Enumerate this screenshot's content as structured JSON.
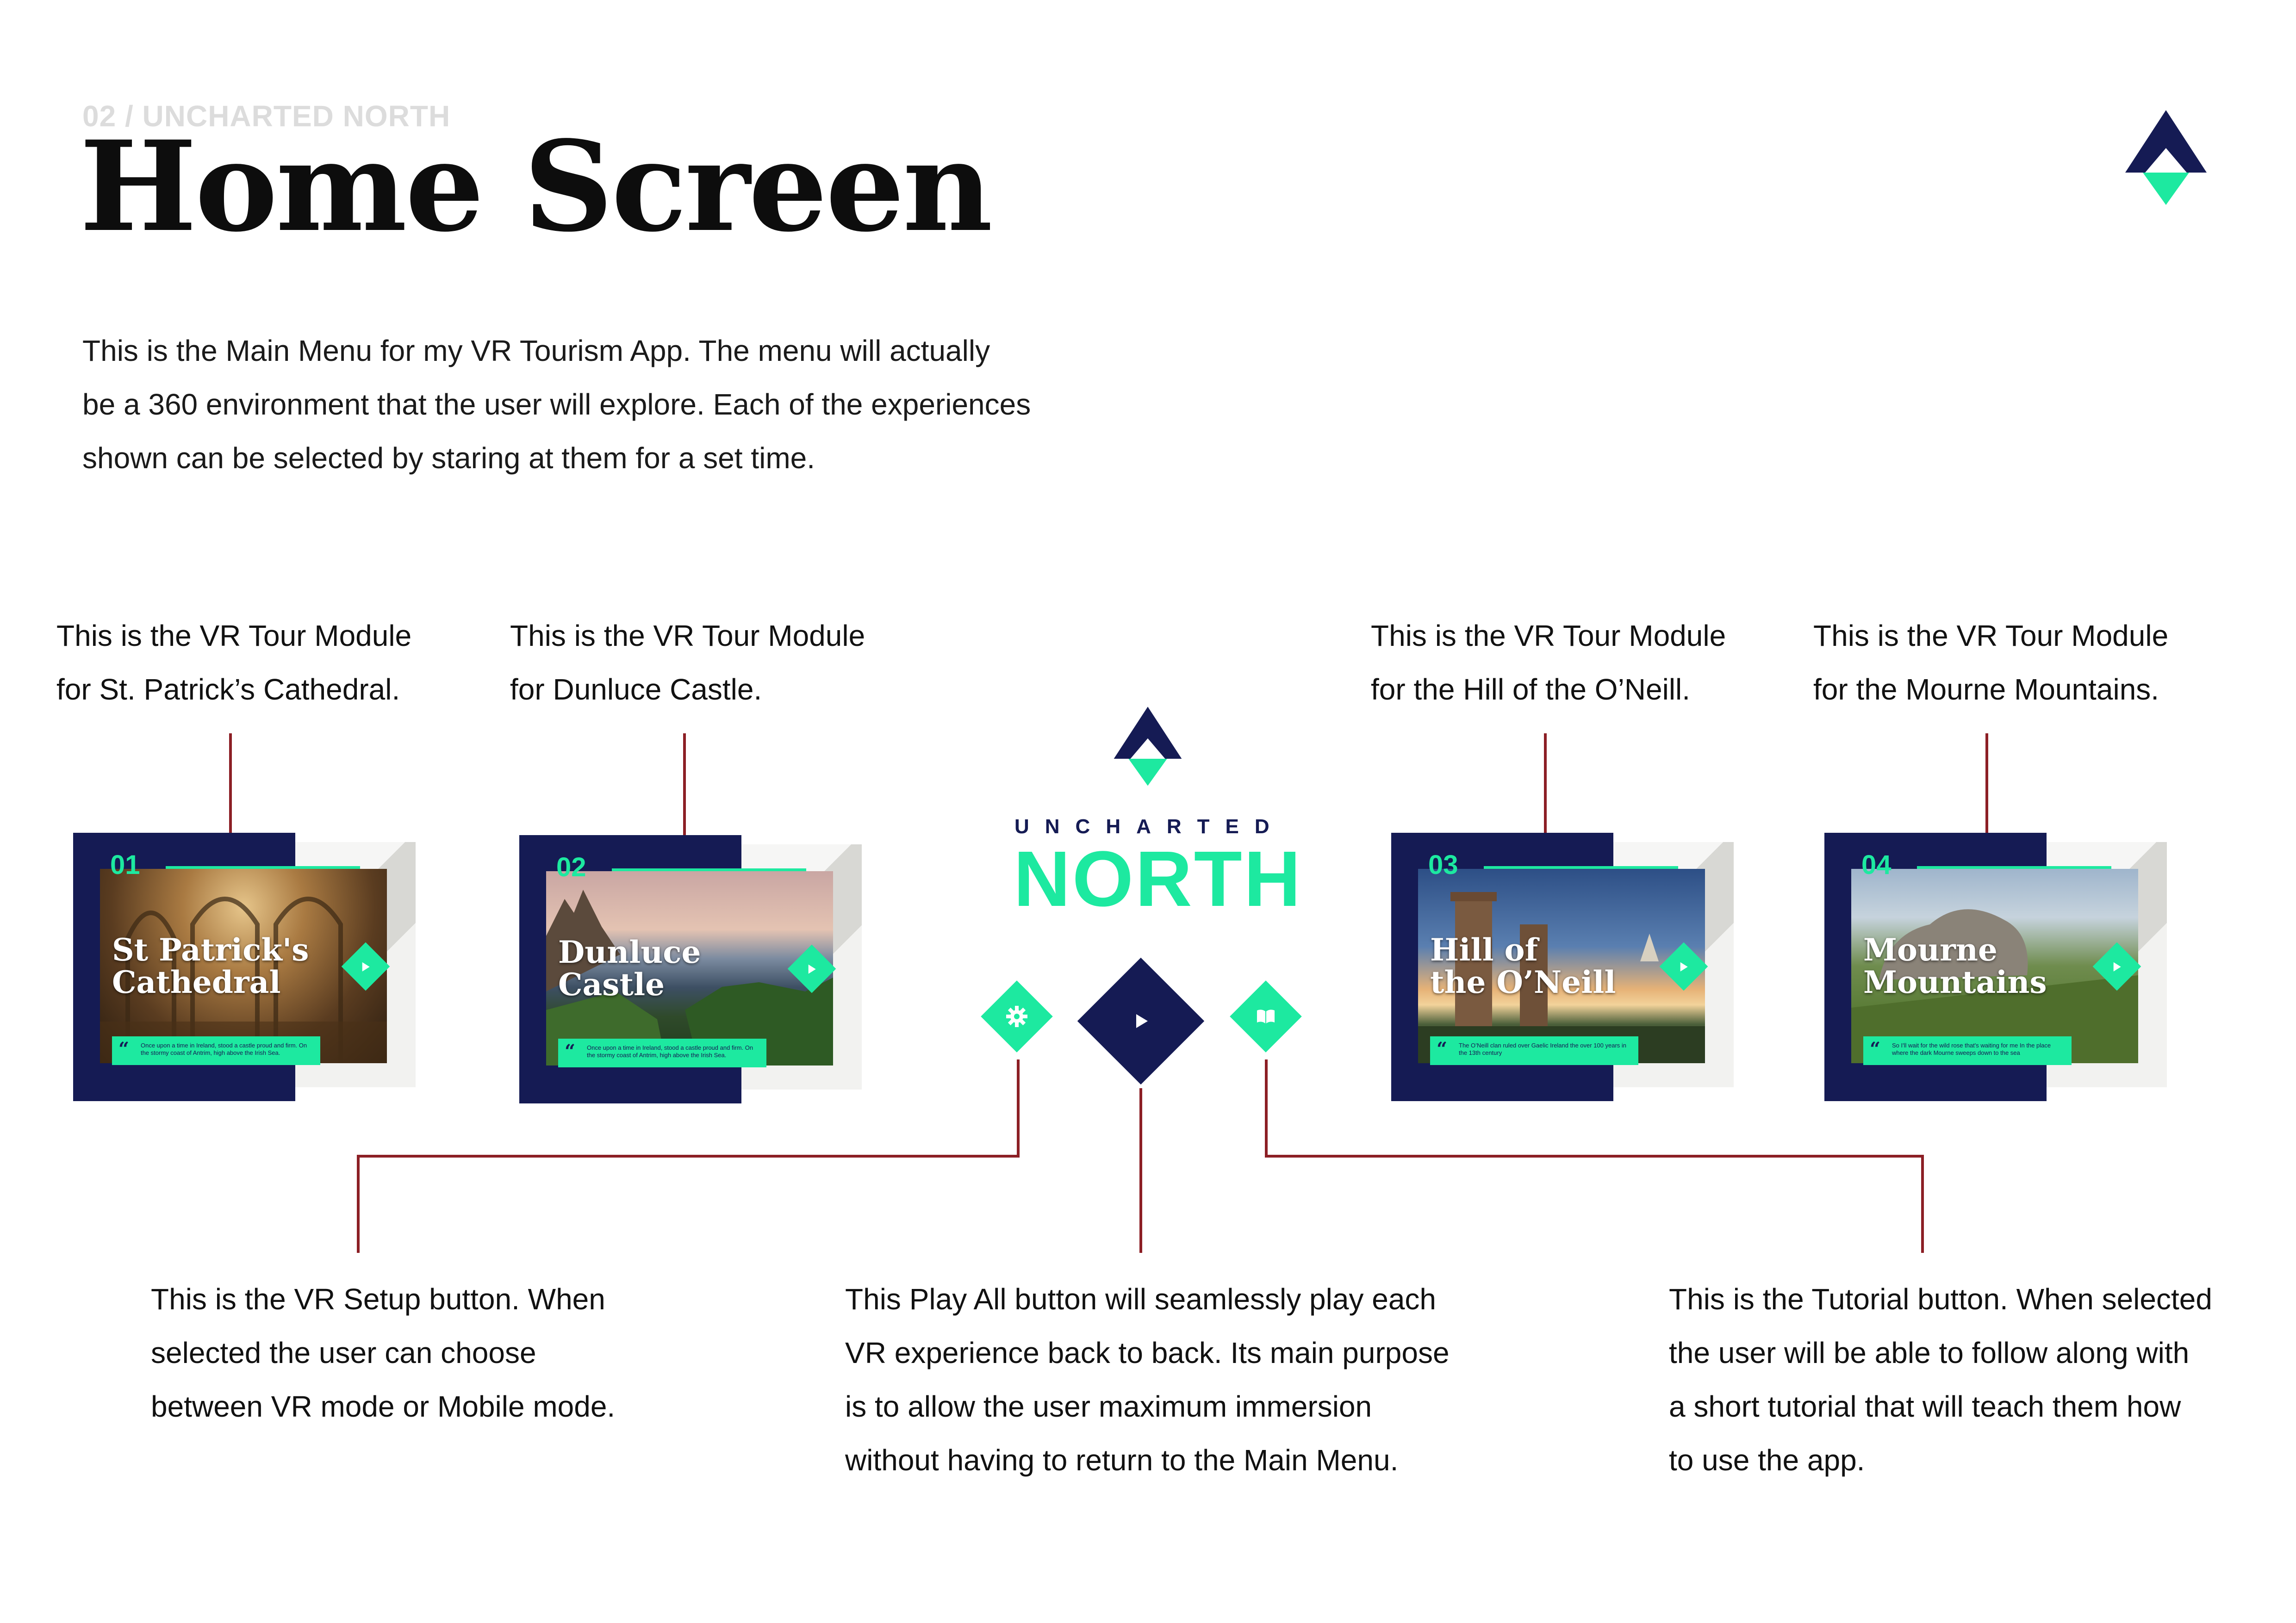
{
  "header": {
    "eyebrow": "02 / UNCHARTED NORTH",
    "title": "Home Screen",
    "intro_lines": [
      "This is the Main Menu for my VR Tourism App. The menu will actually",
      "be a 360 environment that the user will explore. Each of the experiences",
      "shown can be selected by staring at them for a set time."
    ]
  },
  "colors": {
    "navy": "#151b54",
    "mint": "#1de9a0",
    "connector": "#8c1f25"
  },
  "annotations": {
    "st_patricks": [
      "This is the VR Tour Module",
      "for St. Patrick’s Cathedral."
    ],
    "dunluce": [
      "This is the VR Tour Module",
      "for Dunluce Castle."
    ],
    "hill_oneill": [
      "This is the VR Tour Module",
      "for the Hill of the O’Neill."
    ],
    "mourne": [
      "This is the VR Tour Module",
      "for the Mourne Mountains."
    ],
    "setup": [
      "This is the VR Setup button. When",
      "selected the user can choose",
      "between VR mode or Mobile mode."
    ],
    "play_all": [
      "This Play All button will seamlessly play each",
      "VR experience back to back. Its main purpose",
      "is to allow the user maximum immersion",
      "without having to return to the Main Menu."
    ],
    "tutorial": [
      "This is the Tutorial button. When selected",
      "the user will be able to follow along with",
      "a short tutorial that will teach them how",
      "to use the app."
    ]
  },
  "logo": {
    "word_top": "UNCHARTED",
    "word_bottom": "NORTH",
    "icon": "triangle-logo-icon"
  },
  "cards": [
    {
      "number": "01",
      "title_lines": [
        "St Patrick's",
        "Cathedral"
      ],
      "quote": "Once upon a time in Ireland, stood a castle proud and firm. On the stormy coast of Antrim, high above the Irish Sea."
    },
    {
      "number": "02",
      "title_lines": [
        "Dunluce",
        "Castle"
      ],
      "quote": "Once upon a time in Ireland, stood a castle proud and firm. On the stormy coast of Antrim, high above the Irish Sea."
    },
    {
      "number": "03",
      "title_lines": [
        "Hill of",
        "the O’Neill"
      ],
      "quote": "The O’Neill clan ruled over Gaelic Ireland the over 100 years in the 13th century"
    },
    {
      "number": "04",
      "title_lines": [
        "Mourne",
        "Mountains"
      ],
      "quote": "So I'll wait for the wild rose that's waiting for me In the place where the dark Mourne sweeps down to the sea"
    }
  ],
  "buttons": {
    "setup_icon": "gear-icon",
    "play_icon": "play-icon",
    "tutorial_icon": "book-icon"
  }
}
